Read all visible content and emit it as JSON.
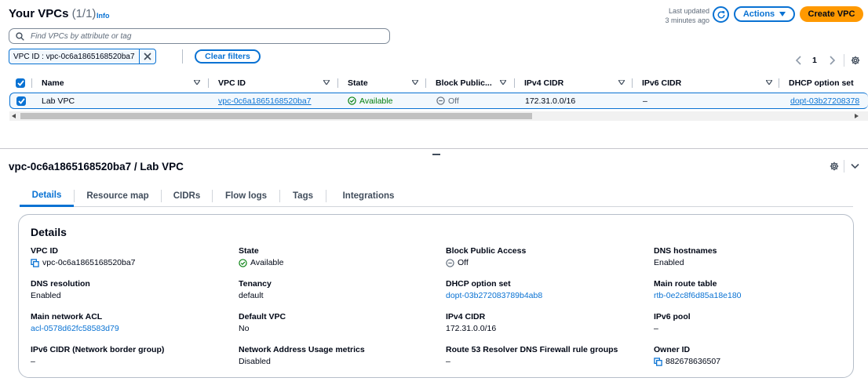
{
  "header": {
    "title": "Your VPCs",
    "count": "(1/1)",
    "info": "Info",
    "last_updated_line1": "Last updated",
    "last_updated_line2": "3 minutes ago",
    "actions_label": "Actions",
    "create_label": "Create VPC"
  },
  "search": {
    "placeholder": "Find VPCs by attribute or tag"
  },
  "filter": {
    "token": "VPC ID : vpc-0c6a1865168520ba7",
    "clear_label": "Clear filters"
  },
  "pagination": {
    "current_page": "1"
  },
  "table": {
    "columns": [
      "Name",
      "VPC ID",
      "State",
      "Block Public...",
      "IPv4 CIDR",
      "IPv6 CIDR",
      "DHCP option set"
    ],
    "row": {
      "name": "Lab VPC",
      "vpc_id": "vpc-0c6a1865168520ba7",
      "state": "Available",
      "block_public": "Off",
      "ipv4_cidr": "172.31.0.0/16",
      "ipv6_cidr": "–",
      "dhcp": "dopt-03b27208378"
    }
  },
  "detail": {
    "title": "vpc-0c6a1865168520ba7 / Lab VPC",
    "tabs": [
      "Details",
      "Resource map",
      "CIDRs",
      "Flow logs",
      "Tags",
      "Integrations"
    ],
    "heading": "Details",
    "fields": {
      "vpc_id": {
        "label": "VPC ID",
        "value": "vpc-0c6a1865168520ba7"
      },
      "state": {
        "label": "State",
        "value": "Available"
      },
      "block_public_access": {
        "label": "Block Public Access",
        "value": "Off"
      },
      "dns_hostnames": {
        "label": "DNS hostnames",
        "value": "Enabled"
      },
      "dns_resolution": {
        "label": "DNS resolution",
        "value": "Enabled"
      },
      "tenancy": {
        "label": "Tenancy",
        "value": "default"
      },
      "dhcp_option_set": {
        "label": "DHCP option set",
        "value": "dopt-03b272083789b4ab8"
      },
      "main_route_table": {
        "label": "Main route table",
        "value": "rtb-0e2c8f6d85a18e180"
      },
      "main_network_acl": {
        "label": "Main network ACL",
        "value": "acl-0578d62fc58583d79"
      },
      "default_vpc": {
        "label": "Default VPC",
        "value": "No"
      },
      "ipv4_cidr": {
        "label": "IPv4 CIDR",
        "value": "172.31.0.0/16"
      },
      "ipv6_pool": {
        "label": "IPv6 pool",
        "value": "–"
      },
      "ipv6_cidr_nbg": {
        "label": "IPv6 CIDR (Network border group)",
        "value": "–"
      },
      "nau_metrics": {
        "label": "Network Address Usage metrics",
        "value": "Disabled"
      },
      "route53_resolver": {
        "label": "Route 53 Resolver DNS Firewall rule groups",
        "value": "–"
      },
      "owner_id": {
        "label": "Owner ID",
        "value": "882678636507"
      }
    }
  },
  "colors": {
    "accent": "#0972d3",
    "primary_button": "#ff9900",
    "success": "#037f0c",
    "muted": "#5f6b7a"
  },
  "icons": [
    "info-link",
    "refresh-icon",
    "caret-down-icon",
    "search-icon",
    "close-icon",
    "chevron-left-icon",
    "chevron-right-icon",
    "gear-icon",
    "check-icon",
    "status-available-icon",
    "status-off-icon",
    "copy-icon",
    "chevron-down-icon"
  ]
}
